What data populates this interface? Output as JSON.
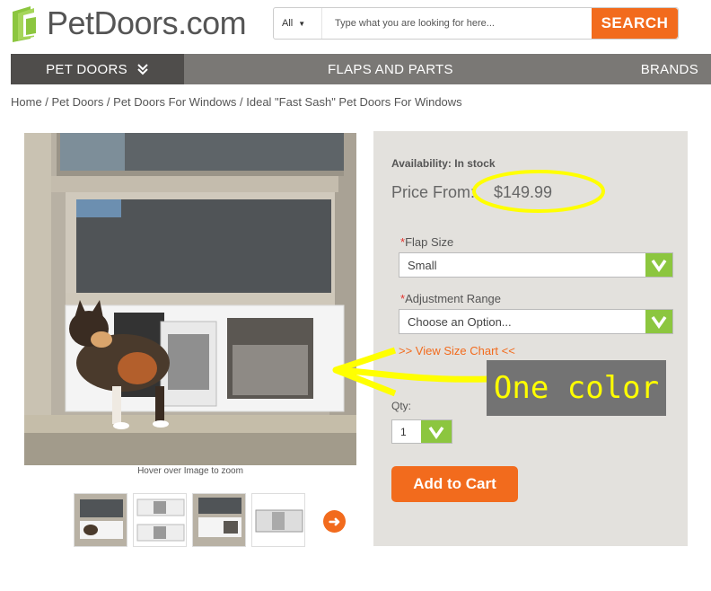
{
  "header": {
    "logo_text": "PetDoors.com",
    "search_scope": "All",
    "search_placeholder": "Type what you are looking for here...",
    "search_button": "SEARCH"
  },
  "nav": {
    "pet_doors": "PET DOORS",
    "flaps": "FLAPS AND PARTS",
    "brands": "BRANDS"
  },
  "breadcrumb": "Home / Pet Doors / Pet Doors For Windows / Ideal \"Fast Sash\" Pet Doors For Windows",
  "product": {
    "zoom_hint": "Hover over Image to zoom",
    "availability": "Availability: In stock",
    "price_label": "Price From:",
    "price_value": "$149.99",
    "flap_size_label": "Flap Size",
    "flap_size_value": "Small",
    "adjust_label": "Adjustment Range",
    "adjust_value": "Choose an Option...",
    "size_chart": ">> View Size Chart <<",
    "qty_label": "Qty:",
    "qty_value": "1",
    "add_to_cart": "Add to Cart"
  },
  "annotation": {
    "text": "One color"
  },
  "colors": {
    "accent": "#f26b1d",
    "nav_dark": "#4f4d4b",
    "nav": "#7a7875",
    "check_green": "#8cc63f",
    "highlight": "#ffff00"
  }
}
